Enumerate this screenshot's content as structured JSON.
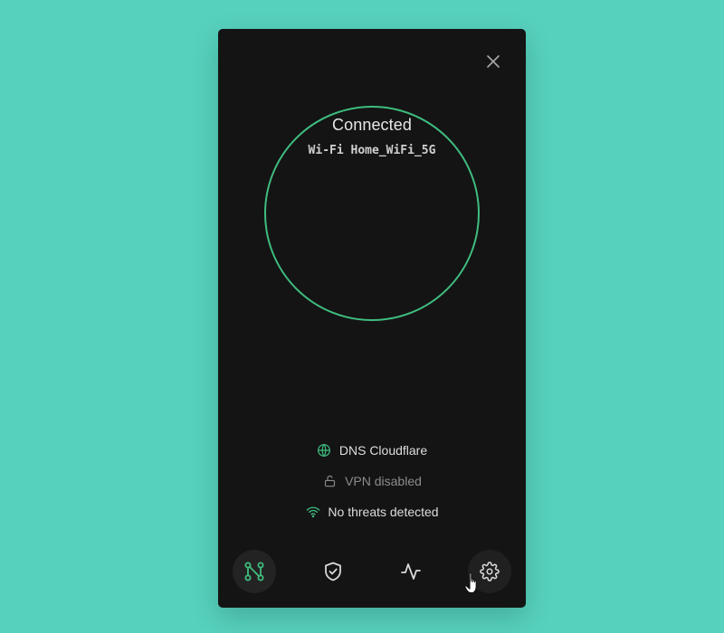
{
  "status": {
    "title": "Connected",
    "network_type": "Wi-Fi",
    "network_name": "Home_WiFi_5G"
  },
  "info": {
    "dns": {
      "label": "DNS",
      "value": "Cloudflare",
      "icon": "globe-icon",
      "state": "on"
    },
    "vpn": {
      "label": "VPN disabled",
      "icon": "lock-open-icon",
      "state": "off"
    },
    "threats": {
      "label": "No threats detected",
      "icon": "wifi-icon",
      "state": "on"
    }
  },
  "nav": [
    {
      "id": "network",
      "icon": "network-nodes-icon",
      "active": true
    },
    {
      "id": "protection",
      "icon": "shield-check-icon",
      "active": false
    },
    {
      "id": "activity",
      "icon": "activity-icon",
      "active": false
    },
    {
      "id": "settings",
      "icon": "gear-icon",
      "active": false,
      "hover": true
    }
  ],
  "colors": {
    "background": "#56d1bd",
    "panel": "#141414",
    "accent": "#3fbd7f",
    "text": "#dddddd",
    "muted": "#8c8c8c"
  }
}
